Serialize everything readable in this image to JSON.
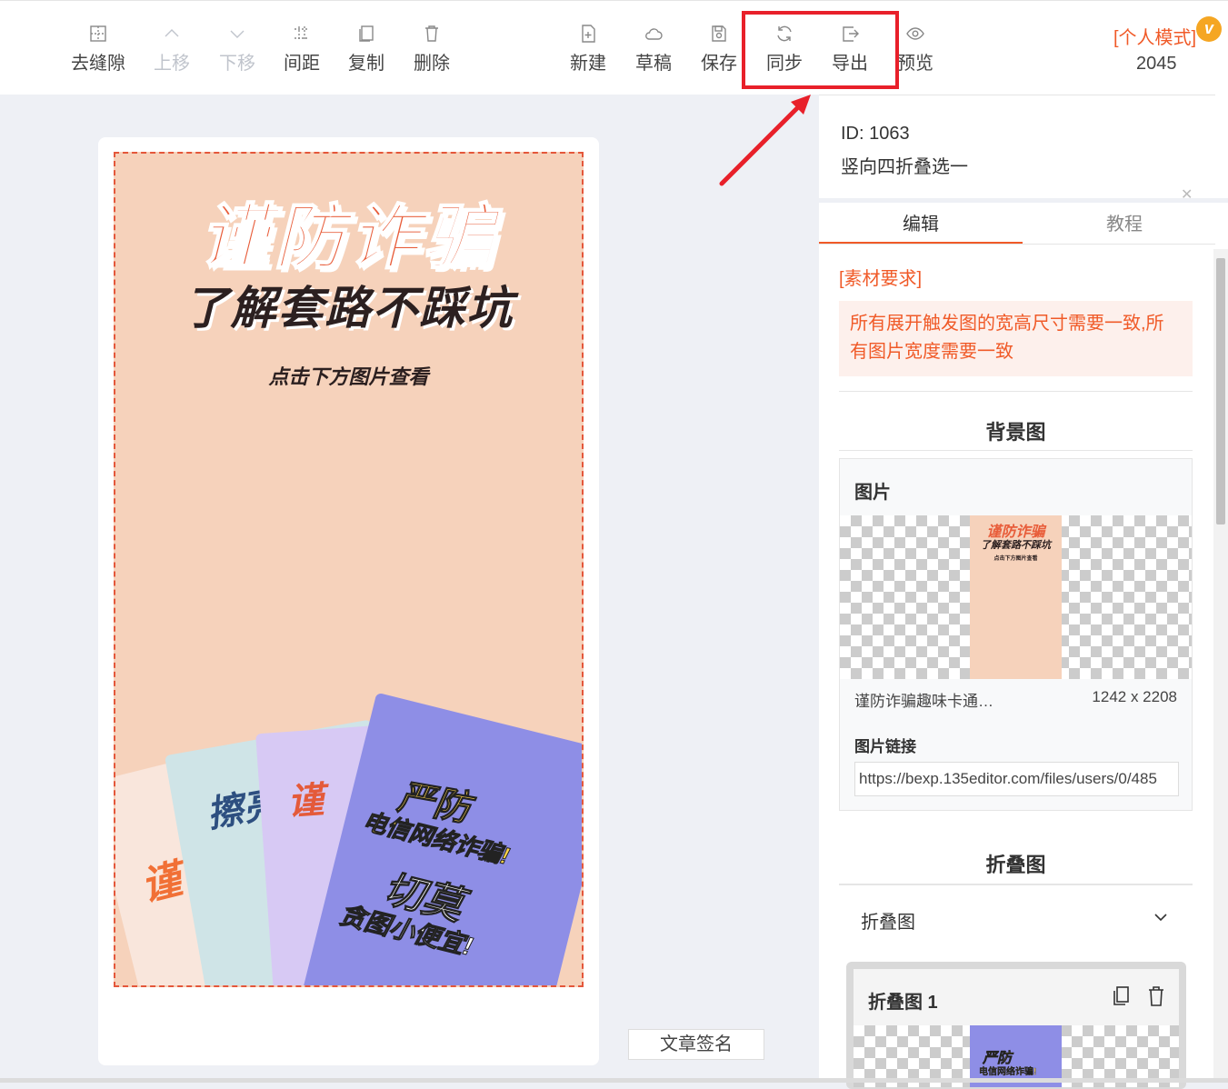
{
  "toolbar": {
    "tools": [
      {
        "label": "去缝隙",
        "icon": "grid-icon",
        "disabled": false
      },
      {
        "label": "上移",
        "icon": "chevron-up-icon",
        "disabled": true
      },
      {
        "label": "下移",
        "icon": "chevron-down-icon",
        "disabled": true
      },
      {
        "label": "间距",
        "icon": "spacing-icon",
        "disabled": false
      },
      {
        "label": "复制",
        "icon": "copy-icon",
        "disabled": false
      },
      {
        "label": "删除",
        "icon": "trash-icon",
        "disabled": false
      },
      {
        "label": "新建",
        "icon": "new-file-icon",
        "disabled": false
      },
      {
        "label": "草稿",
        "icon": "cloud-icon",
        "disabled": false
      },
      {
        "label": "保存",
        "icon": "save-icon",
        "disabled": false
      },
      {
        "label": "同步",
        "icon": "sync-icon",
        "disabled": false
      },
      {
        "label": "导出",
        "icon": "export-icon",
        "disabled": false
      },
      {
        "label": "预览",
        "icon": "eye-icon",
        "disabled": false
      }
    ],
    "mode_label": "[个人模式]",
    "mode_badge": "v",
    "count": "2045"
  },
  "colors": {
    "accent": "#f05a28",
    "highlight": "#e8202a",
    "poster_bg": "#f6d2bb"
  },
  "poster": {
    "title": "谨防诈骗",
    "subtitle": "了解套路不踩坑",
    "hint": "点击下方图片查看",
    "card1": "谨",
    "card2": "擦亮",
    "card3": "谨",
    "card4": {
      "line1": "严防",
      "line2": "电信网络诈骗!",
      "line3": "切莫",
      "line4": "贪图小便宜!"
    }
  },
  "sign_button": "文章签名",
  "panel": {
    "id_text": "ID: 1063",
    "name": "竖向四折叠选一",
    "tabs": [
      "编辑",
      "教程"
    ],
    "requirement_title": "[素材要求]",
    "requirement_text": "所有展开触发图的宽高尺寸需要一致,所有图片宽度需要一致",
    "background_section": "背景图",
    "image_header": "图片",
    "thumb_title": "谨防诈骗",
    "thumb_sub": "了解套路不踩坑",
    "thumb_hint": "点击下方图片查看",
    "file_name": "谨防诈骗趣味卡通…",
    "file_size": "1242 x 2208",
    "link_label": "图片链接",
    "link_value": "https://bexp.135editor.com/files/users/0/485",
    "fold_section": "折叠图",
    "fold_select": "折叠图",
    "fold_item_title": "折叠图 1",
    "fold_thumb_a": "严防",
    "fold_thumb_b": "电信网络诈骗!"
  }
}
